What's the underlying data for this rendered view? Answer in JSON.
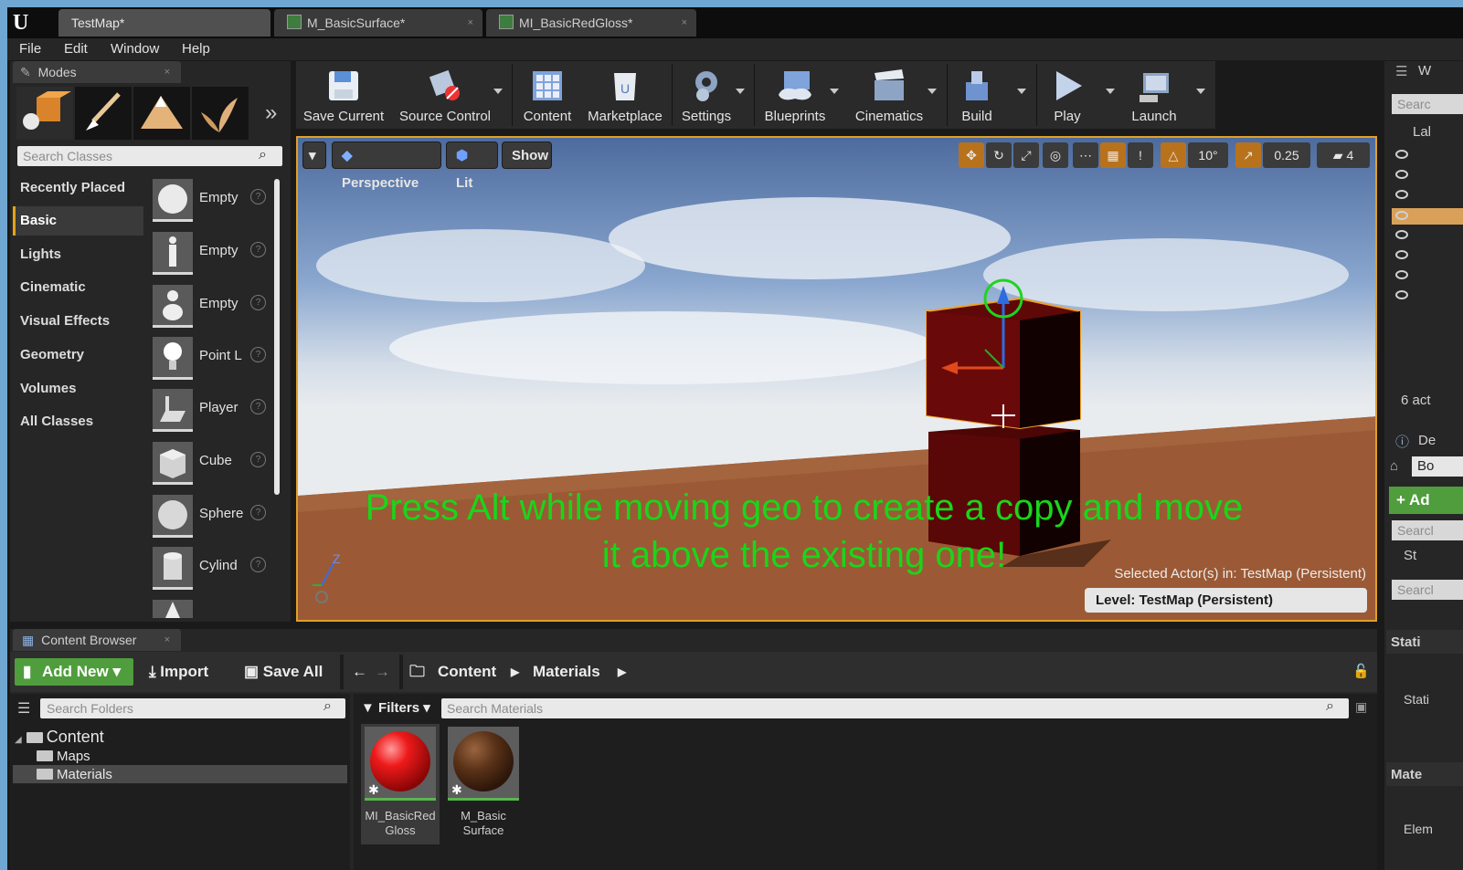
{
  "app": {
    "logo_text": "U"
  },
  "tabs": [
    {
      "label": "TestMap*",
      "close": ""
    },
    {
      "label": "M_BasicSurface*",
      "close": "×"
    },
    {
      "label": "MI_BasicRedGloss*",
      "close": "×"
    }
  ],
  "menu": [
    "File",
    "Edit",
    "Window",
    "Help"
  ],
  "modes": {
    "tab_label": "Modes",
    "search_placeholder": "Search Classes",
    "categories": [
      "Recently Placed",
      "Basic",
      "Lights",
      "Cinematic",
      "Visual Effects",
      "Geometry",
      "Volumes",
      "All Classes"
    ],
    "selected_category": "Basic",
    "items": [
      "Empty",
      "Empty",
      "Empty",
      "Point L",
      "Player",
      "Cube",
      "Sphere",
      "Cylind"
    ]
  },
  "toolbar": {
    "buttons": [
      {
        "label": "Save Current",
        "icon": "save-icon"
      },
      {
        "label": "Source Control",
        "icon": "source-control-icon"
      },
      {
        "label": "Content",
        "icon": "content-icon"
      },
      {
        "label": "Marketplace",
        "icon": "marketplace-icon"
      },
      {
        "label": "Settings",
        "icon": "settings-icon"
      },
      {
        "label": "Blueprints",
        "icon": "blueprints-icon"
      },
      {
        "label": "Cinematics",
        "icon": "cinematics-icon"
      },
      {
        "label": "Build",
        "icon": "build-icon"
      },
      {
        "label": "Play",
        "icon": "play-icon"
      },
      {
        "label": "Launch",
        "icon": "launch-icon"
      }
    ]
  },
  "viewport": {
    "perspective": "Perspective",
    "lit": "Lit",
    "show": "Show",
    "rotation_snap": "10°",
    "scale_snap": "0.25",
    "camera_speed": "4",
    "annotation_line1": "Press Alt while moving geo to create a copy and move",
    "annotation_line2": "it above the existing one!",
    "selected_actors": "Selected Actor(s) in:  TestMap (Persistent)",
    "level_label": "Level:  TestMap (Persistent)",
    "axis_z": "Z"
  },
  "right_panel": {
    "world_tab": "W",
    "search": "Searc",
    "label_col": "Lal",
    "actor_count": "6 act",
    "details_tab": "De",
    "bo": "Bo",
    "add": "+ Ad",
    "search2": "Searcl",
    "st": "St",
    "search3": "Searcl",
    "static_section": "Stati",
    "static_field": "Stati",
    "material_section": "Mate",
    "elem": "Elem"
  },
  "content_browser": {
    "tab_label": "Content Browser",
    "add_new": "Add New",
    "import": "Import",
    "save_all": "Save All",
    "breadcrumb": [
      "Content",
      "Materials"
    ],
    "search_folders": "Search Folders",
    "filters": "Filters",
    "search_materials": "Search Materials",
    "tree": [
      "Content",
      "Maps",
      "Materials"
    ],
    "selected_folder": "Materials",
    "assets": [
      {
        "name_line1": "MI_BasicRed",
        "name_line2": "Gloss",
        "color": "#e01010"
      },
      {
        "name_line1": "M_Basic",
        "name_line2": "Surface",
        "color": "#5a3218"
      }
    ]
  },
  "colors": {
    "accent": "#e5a319",
    "annotation": "#1ad51a",
    "add_new": "#4f9d3c"
  }
}
